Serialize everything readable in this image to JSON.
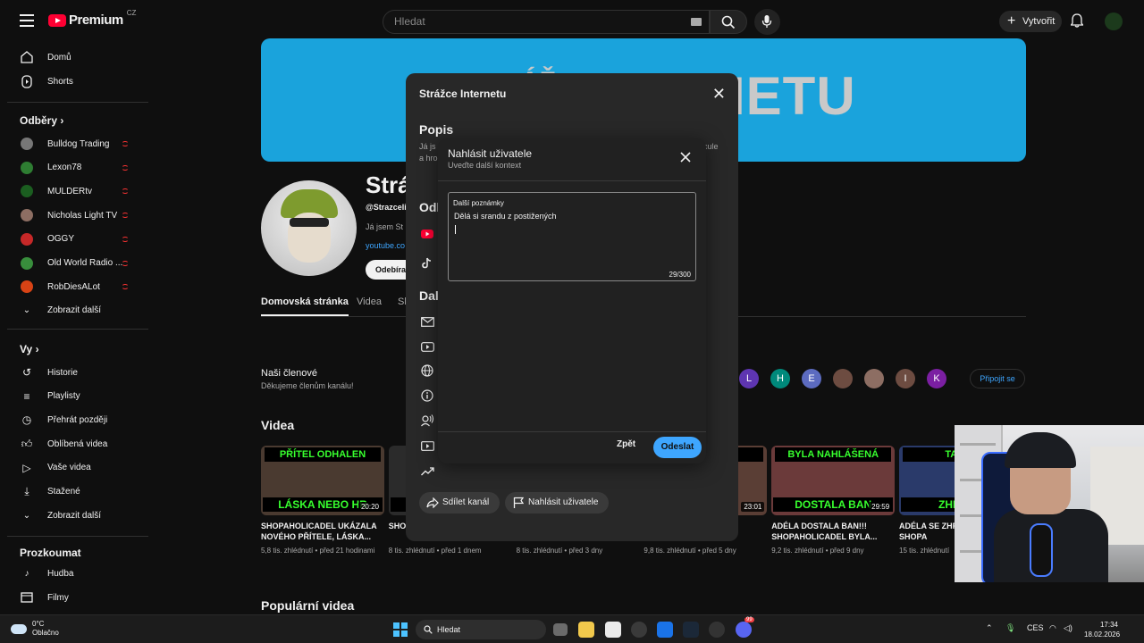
{
  "header": {
    "logo_text": "Premium",
    "logo_region": "CZ",
    "search_placeholder": "Hledat",
    "create_label": "Vytvořit"
  },
  "sidebar": {
    "home": "Domů",
    "shorts": "Shorts",
    "subscriptions_title": "Odběry",
    "subscriptions": [
      {
        "name": "Bulldog Trading",
        "color": "#777777"
      },
      {
        "name": "Lexon78",
        "color": "#2e7d32"
      },
      {
        "name": "MULDERtv",
        "color": "#1b5e20"
      },
      {
        "name": "Nicholas Light TV",
        "color": "#8d6e63"
      },
      {
        "name": "OGGY",
        "color": "#c62828"
      },
      {
        "name": "Old World Radio ...",
        "color": "#388e3c"
      },
      {
        "name": "RobDiesALot",
        "color": "#d84315"
      }
    ],
    "show_more_1": "Zobrazit další",
    "you_title": "Vy",
    "you_items": [
      "Historie",
      "Playlisty",
      "Přehrát později",
      "Oblíbená videa",
      "Vaše videa",
      "Stažené"
    ],
    "show_more_2": "Zobrazit další",
    "explore_title": "Prozkoumat",
    "explore_items": [
      "Hudba",
      "Filmy"
    ]
  },
  "channel": {
    "banner_text_left": "ÁŽ",
    "banner_text": "RNETU",
    "name": "Strá",
    "handle": "@Strazceli",
    "description": "Já jsem St",
    "link": "youtube.co",
    "subscribe_label": "Odebíra",
    "tabs": [
      "Domovská stránka",
      "Videa",
      "Sh"
    ],
    "members_title": "Naši členové",
    "members_subtitle": "Děkujeme členům kanálu!",
    "member_avatars": [
      {
        "letter": "L",
        "color": "#5e35b1"
      },
      {
        "letter": "H",
        "color": "#00897b"
      },
      {
        "letter": "E",
        "color": "#5c6bc0"
      },
      {
        "letter": "",
        "color": "#6d4c41"
      },
      {
        "letter": "",
        "color": "#8d6e63"
      },
      {
        "letter": "I",
        "color": "#6d4c41"
      },
      {
        "letter": "K",
        "color": "#7b1fa2"
      }
    ],
    "join_label": "Připojit se",
    "videos_title": "Videa",
    "popular_title": "Populární videa"
  },
  "videos": [
    {
      "top": "PŘÍTEL ODHALEN",
      "bottom": "LÁSKA NEBO HR",
      "duration": "20:20",
      "title": "SHOPAHOLICADEL UKÁZALA NOVÉHO PŘÍTELE, LÁSKA...",
      "views": "5,8 tis. zhlédnutí",
      "age": "• před 21 hodinami"
    },
    {
      "top": "",
      "bottom": "VI",
      "duration": "",
      "title": "SHO IGNO",
      "views": "8 tis. zhlédnutí",
      "age": "• před 1 dnem"
    },
    {
      "top": "",
      "bottom": "",
      "duration": "",
      "title": "",
      "views": "8 tis. zhlédnutí",
      "age": "• před 3 dny"
    },
    {
      "top": "DĚLE",
      "bottom": "",
      "duration": "23:01",
      "title": "IES",
      "views": "9,8 tis. zhlédnutí",
      "age": "• před 5 dny"
    },
    {
      "top": "BYLA NAHLÁŠENÁ",
      "bottom": "DOSTALA BAN",
      "duration": "29:59",
      "title": "ADÉLA DOSTALA BAN!!! SHOPAHOLICADEL BYLA...",
      "views": "9,2 tis. zhlédnutí",
      "age": "• před 9 dny"
    },
    {
      "top": "TAJNÉ",
      "bottom": "ZHROUT",
      "duration": "",
      "title": "ADÉLA SE ZHR BREČÍ!!! SHOPA",
      "views": "15 tis. zhlédnutí",
      "age": ""
    }
  ],
  "about_modal": {
    "title": "Strážce Internetu",
    "desc_title": "Popis",
    "desc_line1": "Já js",
    "desc_line2": "a hro",
    "desc_right": "cule",
    "links_title": "Odk",
    "more_title": "Dalš",
    "share_label": "Sdílet kanál",
    "report_label": "Nahlásit uživatele"
  },
  "report_modal": {
    "title": "Nahlásit uživatele",
    "subtitle": "Uveďte další kontext",
    "field_label": "Další poznámky",
    "field_value": "Dělá si srandu z postižených",
    "counter": "29/300",
    "back_label": "Zpět",
    "send_label": "Odeslat"
  },
  "taskbar": {
    "temperature": "0°C",
    "weather": "Oblačno",
    "search": "Hledat",
    "lang": "CES",
    "time": "17:34",
    "date": "18.02.2026",
    "discord_badge": "99"
  },
  "colors": {
    "accent": "#3ea6ff",
    "brand_red": "#ff0033",
    "banner": "#1aa3dc"
  }
}
